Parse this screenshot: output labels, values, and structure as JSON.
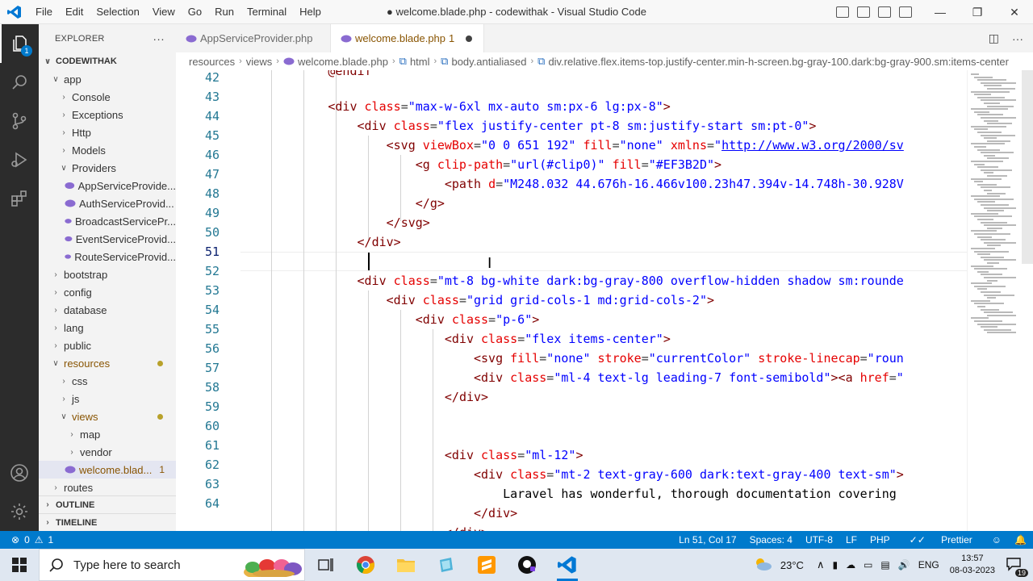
{
  "titlebar": {
    "menu": [
      "File",
      "Edit",
      "Selection",
      "View",
      "Go",
      "Run",
      "Terminal",
      "Help"
    ],
    "title": "● welcome.blade.php - codewithak - Visual Studio Code"
  },
  "activity": {
    "explorer_badge": "1"
  },
  "sidebar": {
    "header": "EXPLORER",
    "more": "···",
    "root": "CODEWITHAK",
    "items": [
      {
        "label": "app",
        "chev": "∨"
      },
      {
        "label": "Console",
        "chev": "›"
      },
      {
        "label": "Exceptions",
        "chev": "›"
      },
      {
        "label": "Http",
        "chev": "›"
      },
      {
        "label": "Models",
        "chev": "›"
      },
      {
        "label": "Providers",
        "chev": "∨"
      },
      {
        "label": "AppServiceProvide..."
      },
      {
        "label": "AuthServiceProvid..."
      },
      {
        "label": "BroadcastServicePr..."
      },
      {
        "label": "EventServiceProvid..."
      },
      {
        "label": "RouteServiceProvid..."
      },
      {
        "label": "bootstrap",
        "chev": "›"
      },
      {
        "label": "config",
        "chev": "›"
      },
      {
        "label": "database",
        "chev": "›"
      },
      {
        "label": "lang",
        "chev": "›"
      },
      {
        "label": "public",
        "chev": "›"
      },
      {
        "label": "resources",
        "chev": "∨"
      },
      {
        "label": "css",
        "chev": "›"
      },
      {
        "label": "js",
        "chev": "›"
      },
      {
        "label": "views",
        "chev": "∨"
      },
      {
        "label": "map",
        "chev": "›"
      },
      {
        "label": "vendor",
        "chev": "›"
      },
      {
        "label": "welcome.blad...",
        "count": "1"
      },
      {
        "label": "routes",
        "chev": "›"
      }
    ],
    "outline": "OUTLINE",
    "timeline": "TIMELINE"
  },
  "tabs": [
    {
      "label": "AppServiceProvider.php"
    },
    {
      "label": "welcome.blade.php",
      "count": "1"
    }
  ],
  "breadcrumb": [
    "resources",
    "views",
    "welcome.blade.php",
    "html",
    "body.antialiased",
    "div.relative.flex.items-top.justify-center.min-h-screen.bg-gray-100.dark:bg-gray-900.sm:items-center"
  ],
  "editor": {
    "line_numbers": [
      "42",
      "43",
      "44",
      "45",
      "46",
      "47",
      "48",
      "49",
      "50",
      "51",
      "52",
      "53",
      "54",
      "55",
      "56",
      "57",
      "58",
      "59",
      "60",
      "61",
      "62",
      "63",
      "64"
    ],
    "current_line": "51"
  },
  "statusbar": {
    "errors": "0",
    "warnings": "1",
    "position": "Ln 51, Col 17",
    "spaces": "Spaces: 4",
    "encoding": "UTF-8",
    "eol": "LF",
    "language": "PHP",
    "prettier": "Prettier"
  },
  "taskbar": {
    "search_placeholder": "Type here to search",
    "weather": "23°C",
    "lang": "ENG",
    "time": "13:57",
    "date": "08-03-2023",
    "notifications": "19"
  },
  "colors": {
    "statusbar": "#007acc",
    "activitybar": "#2c2c2c",
    "tag": "#800000",
    "attr": "#e50000",
    "string": "#0000ff"
  }
}
